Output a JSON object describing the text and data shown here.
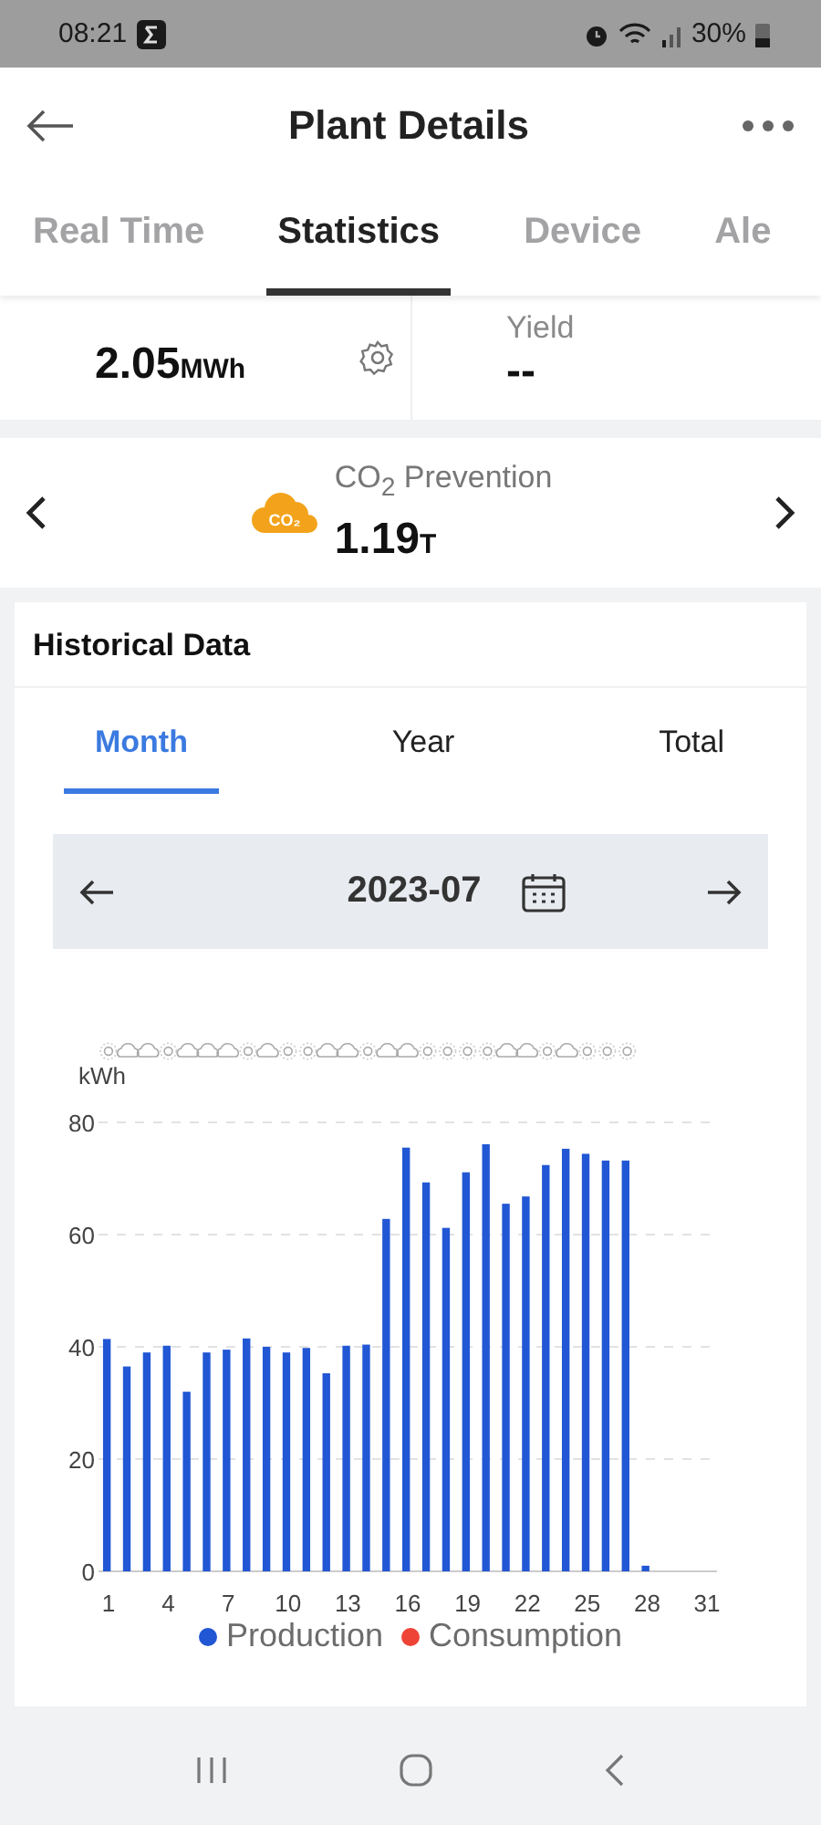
{
  "status_bar": {
    "time": "08:21",
    "battery": "30%"
  },
  "header": {
    "title": "Plant Details"
  },
  "tabs": [
    {
      "label": "Real Time",
      "selected": false
    },
    {
      "label": "Statistics",
      "selected": true
    },
    {
      "label": "Device",
      "selected": false
    },
    {
      "label": "Ale",
      "selected": false
    }
  ],
  "summary": [
    {
      "value": "2.05",
      "unit": "MWh",
      "kind": "production"
    },
    {
      "label": "Yield",
      "value": "--",
      "kind": "anticipated"
    }
  ],
  "co2": {
    "title": "CO$_{2}$ Prevention",
    "badge": "CO₂",
    "value": "1.19",
    "unit": "T"
  },
  "historical": {
    "title": "Historical Data",
    "periods": [
      {
        "label": "Month",
        "selected": true
      },
      {
        "label": "Year",
        "selected": false
      },
      {
        "label": "Total",
        "selected": false
      }
    ],
    "date": "2023-07",
    "weather": [
      {
        "kind": "sun"
      },
      {
        "kind": "cloud"
      },
      {
        "kind": "cloud"
      },
      {
        "kind": "sun"
      },
      {
        "kind": "cloud"
      },
      {
        "kind": "cloud"
      },
      {
        "kind": "cloud"
      },
      {
        "kind": "sun"
      },
      {
        "kind": "cloud"
      },
      {
        "kind": "sun"
      },
      {
        "kind": "sun"
      },
      {
        "kind": "cloud"
      },
      {
        "kind": "cloud"
      },
      {
        "kind": "sun"
      },
      {
        "kind": "cloud"
      },
      {
        "kind": "cloud"
      },
      {
        "kind": "sun"
      },
      {
        "kind": "sun"
      },
      {
        "kind": "sun"
      },
      {
        "kind": "sun"
      },
      {
        "kind": "cloud"
      },
      {
        "kind": "cloud"
      },
      {
        "kind": "sun"
      },
      {
        "kind": "cloud"
      },
      {
        "kind": "sun"
      },
      {
        "kind": "sun"
      },
      {
        "kind": "sun"
      }
    ],
    "chart_data": {
      "type": "bar",
      "ylabel": "kWh",
      "x": [
        1,
        2,
        3,
        4,
        5,
        6,
        7,
        8,
        9,
        10,
        11,
        12,
        13,
        14,
        15,
        16,
        17,
        18,
        19,
        20,
        21,
        22,
        23,
        24,
        25,
        26,
        27,
        28
      ],
      "series": [
        {
          "name": "Production",
          "color": "#2157d4",
          "values": [
            41.4,
            36.5,
            39,
            40.2,
            32,
            39,
            39.5,
            41.5,
            40,
            39,
            39.8,
            35.3,
            40.2,
            40.4,
            62.8,
            75.5,
            69.3,
            61.2,
            71.1,
            76.1,
            65.5,
            66.8,
            72.4,
            75.3,
            74.4,
            73.2,
            73.2,
            1
          ]
        },
        {
          "name": "Consumption",
          "color": "#ee4437",
          "values": [
            null,
            null,
            null,
            null,
            null,
            null,
            null,
            null,
            null,
            null,
            null,
            null,
            null,
            null,
            null,
            null,
            null,
            null,
            null,
            null,
            null,
            null,
            null,
            null,
            null,
            null,
            null,
            null
          ]
        }
      ],
      "xlim": [
        0.5,
        31.5
      ],
      "ylim": [
        0,
        80
      ],
      "yticks": [
        0,
        20,
        40,
        60,
        80
      ],
      "xticks": [
        1,
        4,
        7,
        10,
        13,
        16,
        19,
        22,
        25,
        28,
        31
      ],
      "grid": true
    }
  }
}
